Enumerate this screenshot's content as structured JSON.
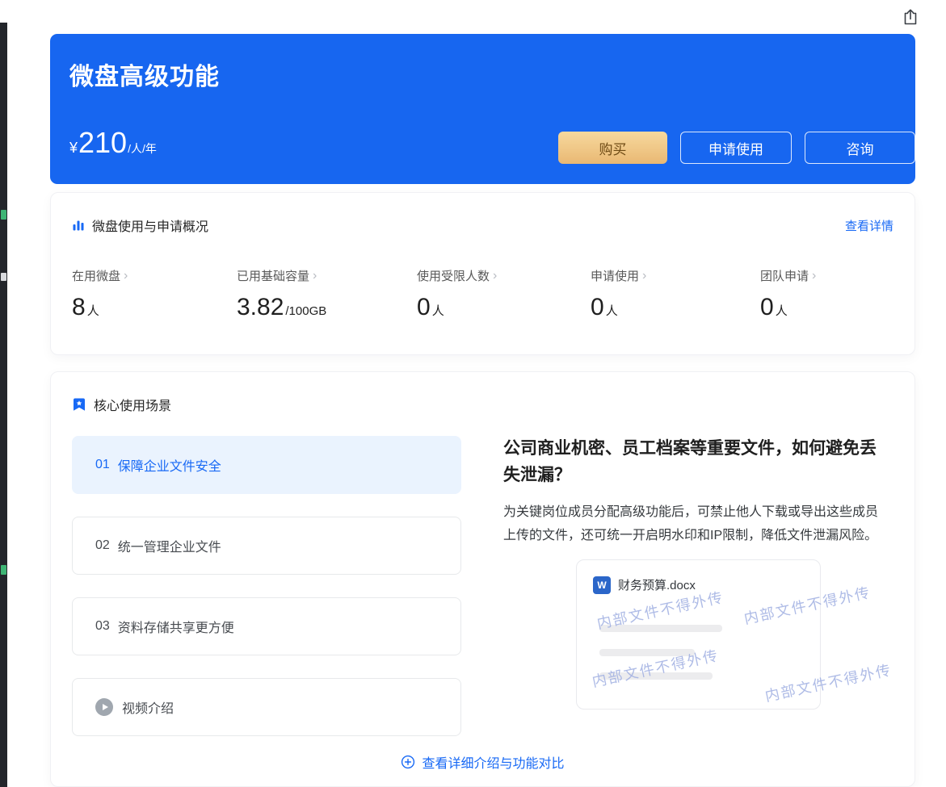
{
  "colors": {
    "accent": "#1869F5",
    "hero_bg": "#1766F0",
    "buy_gold_from": "#F7D99E",
    "buy_gold_to": "#E9B873",
    "buy_text": "#6E4A14",
    "selected_bg": "#EAF3FE",
    "watermark": "#9AAAE0",
    "word_icon_bg": "#2B66C9"
  },
  "icons": {
    "share": "share-export-icon",
    "overview": "bar-chart-icon",
    "scenarios": "bookmark-star-icon",
    "video": "play-icon",
    "compare": "circle-plus-icon",
    "doc": "word-icon",
    "stat_chevron": "›"
  },
  "hero": {
    "title": "微盘高级功能",
    "price": {
      "currency": "¥",
      "value": "210",
      "unit": "/人/年"
    },
    "buttons": {
      "buy": "购买",
      "apply": "申请使用",
      "consult": "咨询"
    }
  },
  "overview": {
    "title": "微盘使用与申请概况",
    "detail_link": "查看详情",
    "stats": [
      {
        "label": "在用微盘",
        "value": "8",
        "suffix": "人"
      },
      {
        "label": "已用基础容量",
        "value": "3.82",
        "suffix": "/100GB"
      },
      {
        "label": "使用受限人数",
        "value": "0",
        "suffix": "人"
      },
      {
        "label": "申请使用",
        "value": "0",
        "suffix": "人"
      },
      {
        "label": "团队申请",
        "value": "0",
        "suffix": "人"
      }
    ]
  },
  "scenarios": {
    "title": "核心使用场景",
    "items": [
      {
        "index": "01",
        "label": "保障企业文件安全",
        "selected": true
      },
      {
        "index": "02",
        "label": "统一管理企业文件",
        "selected": false
      },
      {
        "index": "03",
        "label": "资料存储共享更方便",
        "selected": false
      }
    ],
    "video_label": "视频介绍",
    "content": {
      "heading": "公司商业机密、员工档案等重要文件，如何避免丢失泄漏？",
      "body": "为关键岗位成员分配高级功能后，可禁止他人下载或导出这些成员上传的文件，还可统一开启明水印和IP限制，降低文件泄漏风险。",
      "doc": {
        "icon_letter": "W",
        "filename": "财务预算.docx",
        "watermark": "内部文件不得外传"
      }
    },
    "compare_link": "查看详细介绍与功能对比"
  }
}
